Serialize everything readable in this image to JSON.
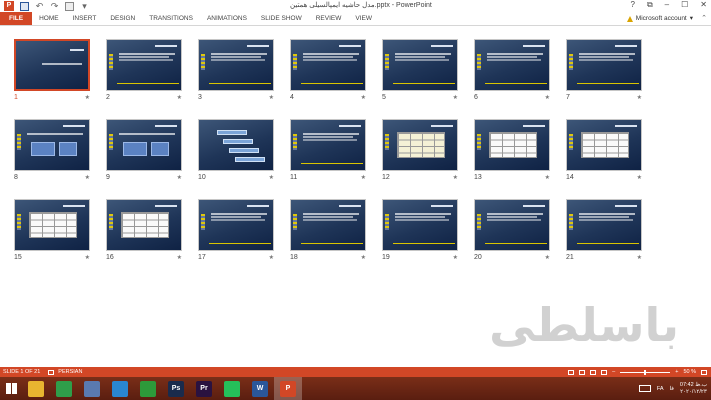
{
  "window": {
    "title": "مدل حاشیه ایمپالسیلی همتین.pptx - PowerPoint",
    "logo_letter": "P",
    "controls": {
      "help": "?",
      "restore": "⧉",
      "minimize": "–",
      "maximize": "☐",
      "close": "✕"
    }
  },
  "ribbon": {
    "tabs": [
      "FILE",
      "HOME",
      "INSERT",
      "DESIGN",
      "TRANSITIONS",
      "ANIMATIONS",
      "SLIDE SHOW",
      "REVIEW",
      "VIEW"
    ],
    "account_label": "Microsoft account",
    "account_chevron": "▾",
    "collapse_glyph": "⌃"
  },
  "quick_access": {
    "undo": "↶",
    "redo": "↷",
    "customize": "▾"
  },
  "slides": {
    "transition_marker": "★",
    "items": [
      {
        "number": "1",
        "kind": "title",
        "selected": true
      },
      {
        "number": "2",
        "kind": "text"
      },
      {
        "number": "3",
        "kind": "text"
      },
      {
        "number": "4",
        "kind": "text"
      },
      {
        "number": "5",
        "kind": "text"
      },
      {
        "number": "6",
        "kind": "text"
      },
      {
        "number": "7",
        "kind": "text"
      },
      {
        "number": "8",
        "kind": "boxes"
      },
      {
        "number": "9",
        "kind": "boxes"
      },
      {
        "number": "10",
        "kind": "steps"
      },
      {
        "number": "11",
        "kind": "text"
      },
      {
        "number": "12",
        "kind": "table"
      },
      {
        "number": "13",
        "kind": "table-white"
      },
      {
        "number": "14",
        "kind": "table-white"
      },
      {
        "number": "15",
        "kind": "table-white"
      },
      {
        "number": "16",
        "kind": "table-white"
      },
      {
        "number": "17",
        "kind": "text"
      },
      {
        "number": "18",
        "kind": "text"
      },
      {
        "number": "19",
        "kind": "text"
      },
      {
        "number": "20",
        "kind": "text"
      },
      {
        "number": "21",
        "kind": "text"
      }
    ]
  },
  "watermark": "باسلطی",
  "status": {
    "slide_indicator": "SLIDE 1 OF 21",
    "language": "PERSIAN",
    "zoom_minus": "–",
    "zoom_plus": "+",
    "zoom": "50 %",
    "zoom_level_fraction": 0.5
  },
  "taskbar": {
    "apps": [
      {
        "name": "file-explorer",
        "label": "",
        "color": "#e8b530",
        "active": false
      },
      {
        "name": "chrome",
        "label": "",
        "color": "#2f9e4a",
        "active": false
      },
      {
        "name": "network-app",
        "label": "",
        "color": "#5a7ab0",
        "active": false
      },
      {
        "name": "recycle-app",
        "label": "",
        "color": "#2a86d1",
        "active": false
      },
      {
        "name": "calculator",
        "label": "",
        "color": "#2d9a3a",
        "active": false
      },
      {
        "name": "photoshop",
        "label": "Ps",
        "color": "#1a2b4c",
        "active": false
      },
      {
        "name": "premiere",
        "label": "Pr",
        "color": "#2a1240",
        "active": false
      },
      {
        "name": "whatsapp",
        "label": "",
        "color": "#25c05a",
        "active": false
      },
      {
        "name": "word",
        "label": "W",
        "color": "#2b579a",
        "active": false
      },
      {
        "name": "powerpoint",
        "label": "P",
        "color": "#d24726",
        "active": true
      }
    ],
    "tray_language": "FA",
    "ime": "فا",
    "clock_time": "07:42 ب.ظ",
    "clock_date": "۲۰۲۰/۱۲/۲۳"
  }
}
